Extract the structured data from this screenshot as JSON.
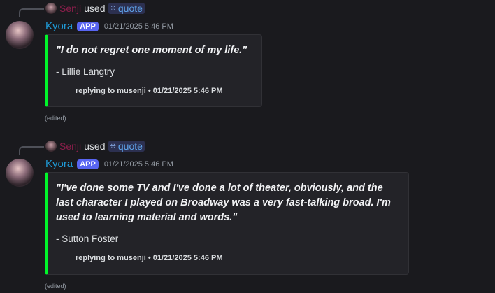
{
  "messages": [
    {
      "invoker": "Senji",
      "used": "used",
      "command": "quote",
      "author": "Kyora",
      "badge": "APP",
      "timestamp": "01/21/2025 5:46 PM",
      "quote": "\"I do not regret one moment of my life.\"",
      "attribution": "- Lillie Langtry",
      "footer": "replying to musenji • 01/21/2025 5:46 PM",
      "edited": "(edited)"
    },
    {
      "invoker": "Senji",
      "used": "used",
      "command": "quote",
      "author": "Kyora",
      "badge": "APP",
      "timestamp": "01/21/2025 5:46 PM",
      "quote": "\"I've done some TV and I've done a lot of theater, obviously, and the last character I played on Broadway was a very fast-talking broad. I'm used to learning material and words.\"",
      "attribution": "- Sutton Foster",
      "footer": "replying to musenji • 01/21/2025 5:46 PM",
      "edited": "(edited)"
    }
  ],
  "colors": {
    "accent_bar": "#00f52a",
    "author": "#1f9ad6",
    "invoker": "#8b1e4b",
    "badge": "#5865f2"
  }
}
